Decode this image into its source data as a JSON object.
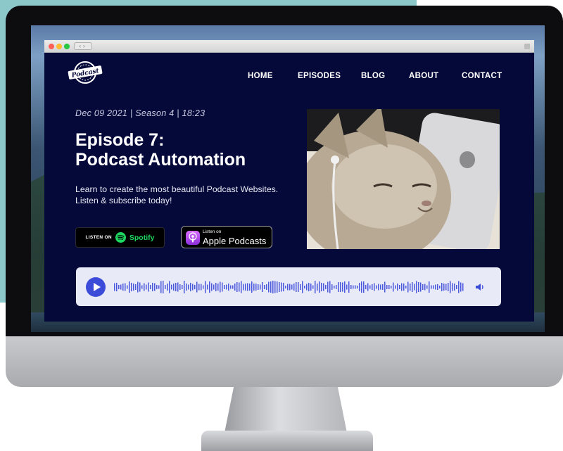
{
  "site": {
    "logo_text": "Podcast",
    "nav": [
      "HOME",
      "EPISODES",
      "BLOG",
      "ABOUT",
      "CONTACT"
    ]
  },
  "episode": {
    "meta": "Dec 09 2021 | Season 4 | 18:23",
    "title_line1": "Episode 7:",
    "title_line2": "Podcast Automation",
    "description": "Learn to create the most beautiful Podcast Websites. Listen & subscribe today!"
  },
  "badges": {
    "spotify_prefix": "LISTEN ON",
    "spotify_name": "Spotify",
    "apple_prefix": "Listen on",
    "apple_name": "Apple Podcasts"
  },
  "colors": {
    "page_bg": "#05093a",
    "accent": "#3d4cd8",
    "player_bg": "#e9eaf7",
    "teal": "#8cc8c9"
  },
  "icons": [
    "play-icon",
    "volume-icon",
    "spotify-icon",
    "apple-podcasts-icon"
  ]
}
